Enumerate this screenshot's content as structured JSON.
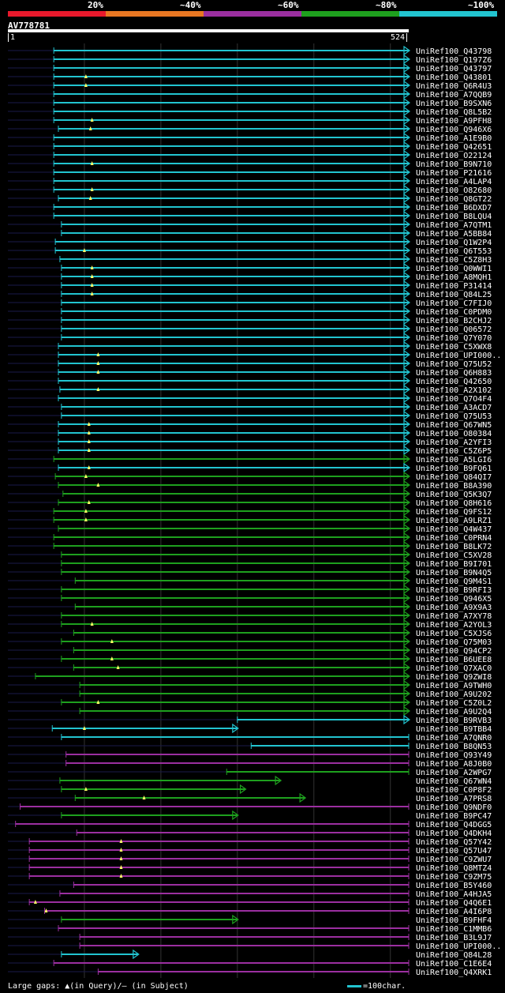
{
  "legend": {
    "labels": [
      "20%",
      "~40%",
      "~60%",
      "~80%",
      "~100%"
    ],
    "colors": [
      "#e8192c",
      "#e87722",
      "#9b2fa0",
      "#1ea01e",
      "#22c4d0"
    ]
  },
  "query": {
    "id": "AV778781",
    "start": "1",
    "end": "524",
    "length": 524
  },
  "footer": {
    "gaps_text": "Large gaps: ▲(in Query)/– (in Subject)",
    "scale_text": "=100char."
  },
  "hits": [
    {
      "label": "UniRef100_Q43798",
      "start": 60,
      "end": 524,
      "color": "#22c4d0",
      "cap": "arrow",
      "gap": null
    },
    {
      "label": "UniRef100_Q197Z6",
      "start": 60,
      "end": 524,
      "color": "#22c4d0",
      "cap": "arrow",
      "gap": null
    },
    {
      "label": "UniRef100_Q43797",
      "start": 60,
      "end": 524,
      "color": "#22c4d0",
      "cap": "arrow",
      "gap": null
    },
    {
      "label": "UniRef100_Q43801",
      "start": 60,
      "end": 524,
      "color": "#22c4d0",
      "cap": "arrow",
      "gap": 102
    },
    {
      "label": "UniRef100_Q6R4U3",
      "start": 60,
      "end": 524,
      "color": "#22c4d0",
      "cap": "arrow",
      "gap": 102
    },
    {
      "label": "UniRef100_A7QQB9",
      "start": 60,
      "end": 524,
      "color": "#22c4d0",
      "cap": "arrow",
      "gap": null
    },
    {
      "label": "UniRef100_B9SXN6",
      "start": 60,
      "end": 524,
      "color": "#22c4d0",
      "cap": "arrow",
      "gap": null
    },
    {
      "label": "UniRef100_Q8L5B2",
      "start": 60,
      "end": 524,
      "color": "#22c4d0",
      "cap": "arrow",
      "gap": null
    },
    {
      "label": "UniRef100_A9PFH8",
      "start": 60,
      "end": 524,
      "color": "#22c4d0",
      "cap": "arrow",
      "gap": 110
    },
    {
      "label": "UniRef100_Q946X6",
      "start": 66,
      "end": 524,
      "color": "#22c4d0",
      "cap": "arrow",
      "gap": 108
    },
    {
      "label": "UniRef100_A1E9B0",
      "start": 60,
      "end": 524,
      "color": "#22c4d0",
      "cap": "arrow",
      "gap": null
    },
    {
      "label": "UniRef100_Q42651",
      "start": 60,
      "end": 524,
      "color": "#22c4d0",
      "cap": "arrow",
      "gap": null
    },
    {
      "label": "UniRef100_O22124",
      "start": 60,
      "end": 524,
      "color": "#22c4d0",
      "cap": "arrow",
      "gap": null
    },
    {
      "label": "UniRef100_B9N710",
      "start": 60,
      "end": 524,
      "color": "#22c4d0",
      "cap": "arrow",
      "gap": 110
    },
    {
      "label": "UniRef100_P21616",
      "start": 60,
      "end": 524,
      "color": "#22c4d0",
      "cap": "arrow",
      "gap": null
    },
    {
      "label": "UniRef100_A4LAP4",
      "start": 60,
      "end": 524,
      "color": "#22c4d0",
      "cap": "arrow",
      "gap": null
    },
    {
      "label": "UniRef100_O82680",
      "start": 60,
      "end": 524,
      "color": "#22c4d0",
      "cap": "arrow",
      "gap": 110
    },
    {
      "label": "UniRef100_Q8GT22",
      "start": 66,
      "end": 524,
      "color": "#22c4d0",
      "cap": "arrow",
      "gap": 108
    },
    {
      "label": "UniRef100_B6DXD7",
      "start": 60,
      "end": 524,
      "color": "#22c4d0",
      "cap": "arrow",
      "gap": null
    },
    {
      "label": "UniRef100_B8LQU4",
      "start": 60,
      "end": 524,
      "color": "#22c4d0",
      "cap": "arrow",
      "gap": null
    },
    {
      "label": "UniRef100_A7QTM1",
      "start": 70,
      "end": 524,
      "color": "#22c4d0",
      "cap": "arrow",
      "gap": null
    },
    {
      "label": "UniRef100_A5BB84",
      "start": 70,
      "end": 524,
      "color": "#22c4d0",
      "cap": "arrow",
      "gap": null
    },
    {
      "label": "UniRef100_Q1W2P4",
      "start": 62,
      "end": 524,
      "color": "#22c4d0",
      "cap": "arrow",
      "gap": null
    },
    {
      "label": "UniRef100_Q6T553",
      "start": 62,
      "end": 524,
      "color": "#22c4d0",
      "cap": "arrow",
      "gap": 100
    },
    {
      "label": "UniRef100_C5Z8H3",
      "start": 68,
      "end": 524,
      "color": "#22c4d0",
      "cap": "arrow",
      "gap": null
    },
    {
      "label": "UniRef100_Q0WWI1",
      "start": 70,
      "end": 524,
      "color": "#22c4d0",
      "cap": "arrow",
      "gap": 110
    },
    {
      "label": "UniRef100_A8MQH1",
      "start": 70,
      "end": 524,
      "color": "#22c4d0",
      "cap": "arrow",
      "gap": 110
    },
    {
      "label": "UniRef100_P31414",
      "start": 70,
      "end": 524,
      "color": "#22c4d0",
      "cap": "arrow",
      "gap": 110
    },
    {
      "label": "UniRef100_Q84L25",
      "start": 70,
      "end": 524,
      "color": "#22c4d0",
      "cap": "arrow",
      "gap": 110
    },
    {
      "label": "UniRef100_C7FIJ0",
      "start": 70,
      "end": 524,
      "color": "#22c4d0",
      "cap": "arrow",
      "gap": null
    },
    {
      "label": "UniRef100_C0PDM0",
      "start": 70,
      "end": 524,
      "color": "#22c4d0",
      "cap": "arrow",
      "gap": null
    },
    {
      "label": "UniRef100_B2CHJ2",
      "start": 70,
      "end": 524,
      "color": "#22c4d0",
      "cap": "arrow",
      "gap": null
    },
    {
      "label": "UniRef100_Q06572",
      "start": 70,
      "end": 524,
      "color": "#22c4d0",
      "cap": "arrow",
      "gap": null
    },
    {
      "label": "UniRef100_Q7Y070",
      "start": 70,
      "end": 524,
      "color": "#22c4d0",
      "cap": "arrow",
      "gap": null
    },
    {
      "label": "UniRef100_C5XWX8",
      "start": 66,
      "end": 524,
      "color": "#22c4d0",
      "cap": "arrow",
      "gap": null
    },
    {
      "label": "UniRef100_UPI000..",
      "start": 66,
      "end": 524,
      "color": "#22c4d0",
      "cap": "arrow",
      "gap": 118
    },
    {
      "label": "UniRef100_Q75U52",
      "start": 66,
      "end": 524,
      "color": "#22c4d0",
      "cap": "arrow",
      "gap": 118
    },
    {
      "label": "UniRef100_Q6H883",
      "start": 66,
      "end": 524,
      "color": "#22c4d0",
      "cap": "arrow",
      "gap": 118
    },
    {
      "label": "UniRef100_Q42650",
      "start": 66,
      "end": 524,
      "color": "#22c4d0",
      "cap": "arrow",
      "gap": null
    },
    {
      "label": "UniRef100_A2X102",
      "start": 68,
      "end": 524,
      "color": "#22c4d0",
      "cap": "arrow",
      "gap": 118
    },
    {
      "label": "UniRef100_Q7O4F4",
      "start": 66,
      "end": 524,
      "color": "#22c4d0",
      "cap": "arrow",
      "gap": null
    },
    {
      "label": "UniRef100_A3ACD7",
      "start": 70,
      "end": 524,
      "color": "#22c4d0",
      "cap": "arrow",
      "gap": null
    },
    {
      "label": "UniRef100_Q75U53",
      "start": 70,
      "end": 524,
      "color": "#22c4d0",
      "cap": "arrow",
      "gap": null
    },
    {
      "label": "UniRef100_Q67WN5",
      "start": 66,
      "end": 524,
      "color": "#22c4d0",
      "cap": "arrow",
      "gap": 106
    },
    {
      "label": "UniRef100_O80384",
      "start": 66,
      "end": 524,
      "color": "#22c4d0",
      "cap": "arrow",
      "gap": 106
    },
    {
      "label": "UniRef100_A2YFI3",
      "start": 66,
      "end": 524,
      "color": "#22c4d0",
      "cap": "arrow",
      "gap": 106
    },
    {
      "label": "UniRef100_C5Z6P5",
      "start": 66,
      "end": 524,
      "color": "#22c4d0",
      "cap": "arrow",
      "gap": 106
    },
    {
      "label": "UniRef100_A5LGI6",
      "start": 60,
      "end": 524,
      "color": "#1ea01e",
      "cap": "arrow",
      "gap": null
    },
    {
      "label": "UniRef100_B9FQ61",
      "start": 66,
      "end": 524,
      "color": "#22c4d0",
      "cap": "arrow",
      "gap": 106
    },
    {
      "label": "UniRef100_Q84QI7",
      "start": 62,
      "end": 524,
      "color": "#1ea01e",
      "cap": "arrow",
      "gap": 102
    },
    {
      "label": "UniRef100_B8A390",
      "start": 66,
      "end": 524,
      "color": "#1ea01e",
      "cap": "arrow",
      "gap": 118
    },
    {
      "label": "UniRef100_Q5K3Q7",
      "start": 72,
      "end": 524,
      "color": "#1ea01e",
      "cap": "arrow",
      "gap": null
    },
    {
      "label": "UniRef100_Q8H616",
      "start": 66,
      "end": 524,
      "color": "#1ea01e",
      "cap": "arrow",
      "gap": 106
    },
    {
      "label": "UniRef100_Q9FS12",
      "start": 60,
      "end": 524,
      "color": "#1ea01e",
      "cap": "arrow",
      "gap": 102
    },
    {
      "label": "UniRef100_A9LRZ1",
      "start": 60,
      "end": 524,
      "color": "#1ea01e",
      "cap": "arrow",
      "gap": 102
    },
    {
      "label": "UniRef100_Q4W437",
      "start": 66,
      "end": 524,
      "color": "#1ea01e",
      "cap": "arrow",
      "gap": null
    },
    {
      "label": "UniRef100_C0PRN4",
      "start": 60,
      "end": 524,
      "color": "#1ea01e",
      "cap": "arrow",
      "gap": null
    },
    {
      "label": "UniRef100_B8LK72",
      "start": 60,
      "end": 524,
      "color": "#1ea01e",
      "cap": "arrow",
      "gap": null
    },
    {
      "label": "UniRef100_C5XV28",
      "start": 70,
      "end": 524,
      "color": "#1ea01e",
      "cap": "arrow",
      "gap": null
    },
    {
      "label": "UniRef100_B9I701",
      "start": 70,
      "end": 524,
      "color": "#1ea01e",
      "cap": "arrow",
      "gap": null
    },
    {
      "label": "UniRef100_B9N4Q5",
      "start": 70,
      "end": 524,
      "color": "#1ea01e",
      "cap": "arrow",
      "gap": null
    },
    {
      "label": "UniRef100_Q9M4S1",
      "start": 88,
      "end": 524,
      "color": "#1ea01e",
      "cap": "arrow",
      "gap": null
    },
    {
      "label": "UniRef100_B9RFI3",
      "start": 70,
      "end": 524,
      "color": "#1ea01e",
      "cap": "arrow",
      "gap": null
    },
    {
      "label": "UniRef100_Q946X5",
      "start": 70,
      "end": 524,
      "color": "#1ea01e",
      "cap": "arrow",
      "gap": null
    },
    {
      "label": "UniRef100_A9X9A3",
      "start": 88,
      "end": 524,
      "color": "#1ea01e",
      "cap": "arrow",
      "gap": null
    },
    {
      "label": "UniRef100_A7XY78",
      "start": 70,
      "end": 524,
      "color": "#1ea01e",
      "cap": "arrow",
      "gap": null
    },
    {
      "label": "UniRef100_A2YOL3",
      "start": 70,
      "end": 524,
      "color": "#1ea01e",
      "cap": "arrow",
      "gap": 110
    },
    {
      "label": "UniRef100_C5XJS6",
      "start": 86,
      "end": 524,
      "color": "#1ea01e",
      "cap": "arrow",
      "gap": null
    },
    {
      "label": "UniRef100_Q75M03",
      "start": 70,
      "end": 524,
      "color": "#1ea01e",
      "cap": "arrow",
      "gap": 136
    },
    {
      "label": "UniRef100_Q94CP2",
      "start": 86,
      "end": 524,
      "color": "#1ea01e",
      "cap": "arrow",
      "gap": null
    },
    {
      "label": "UniRef100_B6UEE8",
      "start": 70,
      "end": 524,
      "color": "#1ea01e",
      "cap": "arrow",
      "gap": 136
    },
    {
      "label": "UniRef100_Q7XAC0",
      "start": 86,
      "end": 524,
      "color": "#1ea01e",
      "cap": "arrow",
      "gap": 144
    },
    {
      "label": "UniRef100_Q9ZWI8",
      "start": 36,
      "end": 524,
      "color": "#1ea01e",
      "cap": "arrow",
      "gap": null
    },
    {
      "label": "UniRef100_A9TWH0",
      "start": 94,
      "end": 524,
      "color": "#1ea01e",
      "cap": "arrow",
      "gap": null
    },
    {
      "label": "UniRef100_A9U202",
      "start": 94,
      "end": 524,
      "color": "#1ea01e",
      "cap": "arrow",
      "gap": null
    },
    {
      "label": "UniRef100_C5Z0L2",
      "start": 70,
      "end": 524,
      "color": "#1ea01e",
      "cap": "arrow",
      "gap": 118
    },
    {
      "label": "UniRef100_A9U2Q4",
      "start": 94,
      "end": 524,
      "color": "#1ea01e",
      "cap": "arrow",
      "gap": null
    },
    {
      "label": "UniRef100_B9RVB3",
      "start": 300,
      "end": 524,
      "color": "#22c4d0",
      "cap": "arrow",
      "gap": null
    },
    {
      "label": "UniRef100_B9TBB4",
      "start": 58,
      "end": 300,
      "color": "#22c4d0",
      "cap": "arrow",
      "gap": 100
    },
    {
      "label": "UniRef100_A7QNR0",
      "start": 70,
      "end": 524,
      "color": "#22c4d0",
      "cap": "bar",
      "gap": null
    },
    {
      "label": "UniRef100_B8QN53",
      "start": 318,
      "end": 524,
      "color": "#22c4d0",
      "cap": "bar",
      "gap": null
    },
    {
      "label": "UniRef100_Q93Y49",
      "start": 76,
      "end": 524,
      "color": "#9b2fa0",
      "cap": "bar",
      "gap": null
    },
    {
      "label": "UniRef100_A8J0B0",
      "start": 76,
      "end": 524,
      "color": "#9b2fa0",
      "cap": "bar",
      "gap": null
    },
    {
      "label": "UniRef100_A2WPG7",
      "start": 286,
      "end": 524,
      "color": "#1ea01e",
      "cap": "bar",
      "gap": null
    },
    {
      "label": "UniRef100_Q67WN4",
      "start": 68,
      "end": 356,
      "color": "#1ea01e",
      "cap": "arrow",
      "gap": null
    },
    {
      "label": "UniRef100_C0P8F2",
      "start": 70,
      "end": 310,
      "color": "#1ea01e",
      "cap": "arrow",
      "gap": 102
    },
    {
      "label": "UniRef100_A7PRS8",
      "start": 88,
      "end": 388,
      "color": "#1ea01e",
      "cap": "arrow",
      "gap": 178
    },
    {
      "label": "UniRef100_Q9NDF0",
      "start": 16,
      "end": 524,
      "color": "#9b2fa0",
      "cap": "bar",
      "gap": null
    },
    {
      "label": "UniRef100_B9PC47",
      "start": 70,
      "end": 300,
      "color": "#1ea01e",
      "cap": "arrow",
      "gap": null
    },
    {
      "label": "UniRef100_Q4DGG5",
      "start": 10,
      "end": 524,
      "color": "#9b2fa0",
      "cap": "bar",
      "gap": null
    },
    {
      "label": "UniRef100_Q4DKH4",
      "start": 90,
      "end": 524,
      "color": "#9b2fa0",
      "cap": "bar",
      "gap": null
    },
    {
      "label": "UniRef100_Q57Y42",
      "start": 28,
      "end": 524,
      "color": "#9b2fa0",
      "cap": "bar",
      "gap": 148
    },
    {
      "label": "UniRef100_Q57U47",
      "start": 28,
      "end": 524,
      "color": "#9b2fa0",
      "cap": "bar",
      "gap": 148
    },
    {
      "label": "UniRef100_C9ZWU7",
      "start": 28,
      "end": 524,
      "color": "#9b2fa0",
      "cap": "bar",
      "gap": 148
    },
    {
      "label": "UniRef100_Q8MTZ4",
      "start": 28,
      "end": 524,
      "color": "#9b2fa0",
      "cap": "bar",
      "gap": 148
    },
    {
      "label": "UniRef100_C9ZM75",
      "start": 28,
      "end": 524,
      "color": "#9b2fa0",
      "cap": "bar",
      "gap": 148
    },
    {
      "label": "UniRef100_B5Y460",
      "start": 86,
      "end": 524,
      "color": "#9b2fa0",
      "cap": "bar",
      "gap": null
    },
    {
      "label": "UniRef100_A4HJA5",
      "start": 68,
      "end": 524,
      "color": "#9b2fa0",
      "cap": "bar",
      "gap": null
    },
    {
      "label": "UniRef100_Q4Q6E1",
      "start": 28,
      "end": 524,
      "color": "#9b2fa0",
      "cap": "bar",
      "gap": 36
    },
    {
      "label": "UniRef100_A4I6P8",
      "start": 48,
      "end": 524,
      "color": "#9b2fa0",
      "cap": "bar",
      "gap": 50
    },
    {
      "label": "UniRef100_B9FHF4",
      "start": 70,
      "end": 300,
      "color": "#1ea01e",
      "cap": "arrow",
      "gap": null
    },
    {
      "label": "UniRef100_C1MMB6",
      "start": 66,
      "end": 524,
      "color": "#9b2fa0",
      "cap": "bar",
      "gap": null
    },
    {
      "label": "UniRef100_B3L9J7",
      "start": 94,
      "end": 524,
      "color": "#9b2fa0",
      "cap": "bar",
      "gap": null
    },
    {
      "label": "UniRef100_UPI000..",
      "start": 94,
      "end": 524,
      "color": "#9b2fa0",
      "cap": "bar",
      "gap": null
    },
    {
      "label": "UniRef100_Q84L28",
      "start": 70,
      "end": 170,
      "color": "#22c4d0",
      "cap": "arrow",
      "gap": null
    },
    {
      "label": "UniRef100_C1E6E4",
      "start": 60,
      "end": 524,
      "color": "#9b2fa0",
      "cap": "bar",
      "gap": null
    },
    {
      "label": "UniRef100_Q4XRK1",
      "start": 118,
      "end": 524,
      "color": "#9b2fa0",
      "cap": "bar",
      "gap": null
    }
  ]
}
